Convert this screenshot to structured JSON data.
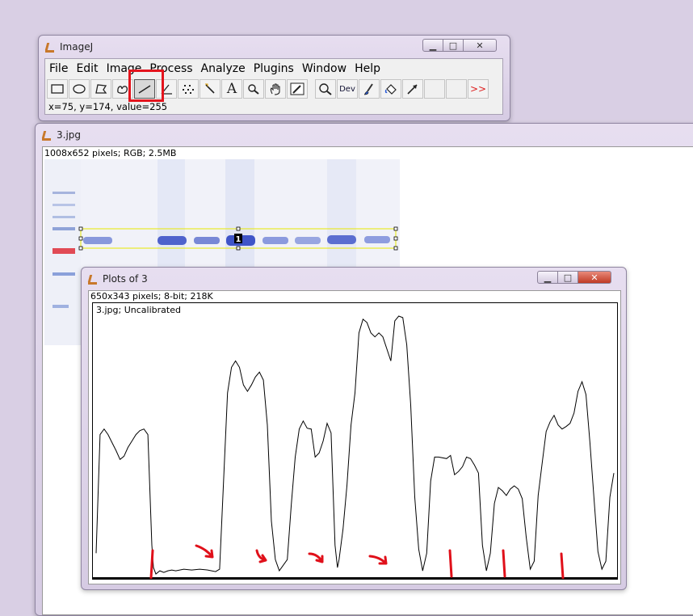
{
  "imagej": {
    "title": "ImageJ",
    "menu": [
      "File",
      "Edit",
      "Image",
      "Process",
      "Analyze",
      "Plugins",
      "Window",
      "Help"
    ],
    "tools": [
      {
        "name": "rectangle-tool-icon"
      },
      {
        "name": "oval-tool-icon"
      },
      {
        "name": "polygon-tool-icon"
      },
      {
        "name": "freehand-tool-icon"
      },
      {
        "name": "straight-line-tool-icon"
      },
      {
        "name": "angle-tool-icon"
      },
      {
        "name": "point-tool-icon"
      },
      {
        "name": "wand-tool-icon"
      },
      {
        "name": "text-tool-icon",
        "glyph": "A"
      },
      {
        "name": "magnifier-tool-icon"
      },
      {
        "name": "hand-tool-icon"
      },
      {
        "name": "color-picker-icon"
      },
      {
        "name": "zoom-icon"
      },
      {
        "name": "dev-menu",
        "glyph": "Dev"
      },
      {
        "name": "brush-icon"
      },
      {
        "name": "flood-fill-icon"
      },
      {
        "name": "arrow-tool-icon"
      },
      {
        "name": "empty-slot"
      },
      {
        "name": "empty-slot"
      },
      {
        "name": "more-tools-icon",
        "glyph": ">>"
      }
    ],
    "status": "x=75, y=174, value=255"
  },
  "image_window": {
    "title": "3.jpg",
    "info": "1008x652 pixels; RGB; 2.5MB",
    "roi_label": "1"
  },
  "plot_window": {
    "title": "Plots of 3",
    "info": "650x343 pixels; 8-bit; 218K",
    "plot_label": "3.jpg; Uncalibrated"
  },
  "chart_data": {
    "type": "line",
    "title": "",
    "xlabel": "",
    "ylabel": "",
    "grid": false,
    "x": [
      0,
      5,
      10,
      15,
      20,
      25,
      30,
      35,
      40,
      45,
      50,
      55,
      60,
      65,
      70,
      72,
      75,
      80,
      85,
      90,
      95,
      100,
      110,
      120,
      130,
      140,
      150,
      155,
      160,
      165,
      170,
      175,
      180,
      185,
      190,
      195,
      200,
      205,
      210,
      215,
      220,
      225,
      230,
      240,
      245,
      250,
      255,
      260,
      265,
      270,
      275,
      280,
      285,
      290,
      295,
      300,
      303,
      305,
      310,
      315,
      320,
      325,
      330,
      335,
      340,
      345,
      350,
      355,
      360,
      370,
      375,
      380,
      385,
      390,
      395,
      400,
      405,
      410,
      415,
      420,
      425,
      430,
      440,
      445,
      450,
      455,
      460,
      465,
      470,
      475,
      480,
      485,
      490,
      495,
      500,
      505,
      510,
      515,
      520,
      525,
      530,
      535,
      540,
      545,
      550,
      555,
      560,
      565,
      570,
      575,
      580,
      585,
      590,
      595,
      600,
      605,
      610,
      615,
      620,
      625,
      630,
      635,
      640,
      645,
      650
    ],
    "values": [
      30,
      178,
      185,
      178,
      168,
      158,
      147,
      151,
      162,
      170,
      178,
      183,
      185,
      178,
      40,
      12,
      4,
      8,
      6,
      8,
      9,
      8,
      10,
      9,
      10,
      9,
      7,
      10,
      120,
      230,
      262,
      270,
      262,
      240,
      232,
      240,
      250,
      256,
      246,
      190,
      70,
      22,
      8,
      22,
      90,
      150,
      185,
      195,
      186,
      185,
      150,
      155,
      170,
      192,
      180,
      40,
      12,
      22,
      60,
      115,
      190,
      230,
      305,
      322,
      318,
      305,
      300,
      305,
      300,
      270,
      320,
      326,
      324,
      290,
      215,
      100,
      35,
      8,
      30,
      120,
      150,
      150,
      148,
      152,
      128,
      132,
      138,
      150,
      148,
      140,
      130,
      40,
      8,
      30,
      92,
      112,
      108,
      102,
      110,
      114,
      110,
      98,
      50,
      10,
      20,
      102,
      142,
      182,
      194,
      202,
      190,
      185,
      188,
      192,
      205,
      232,
      244,
      228,
      168,
      100,
      32,
      10,
      20,
      100,
      130,
      126,
      120,
      115,
      106,
      108,
      100,
      102,
      96,
      92,
      28
    ]
  }
}
